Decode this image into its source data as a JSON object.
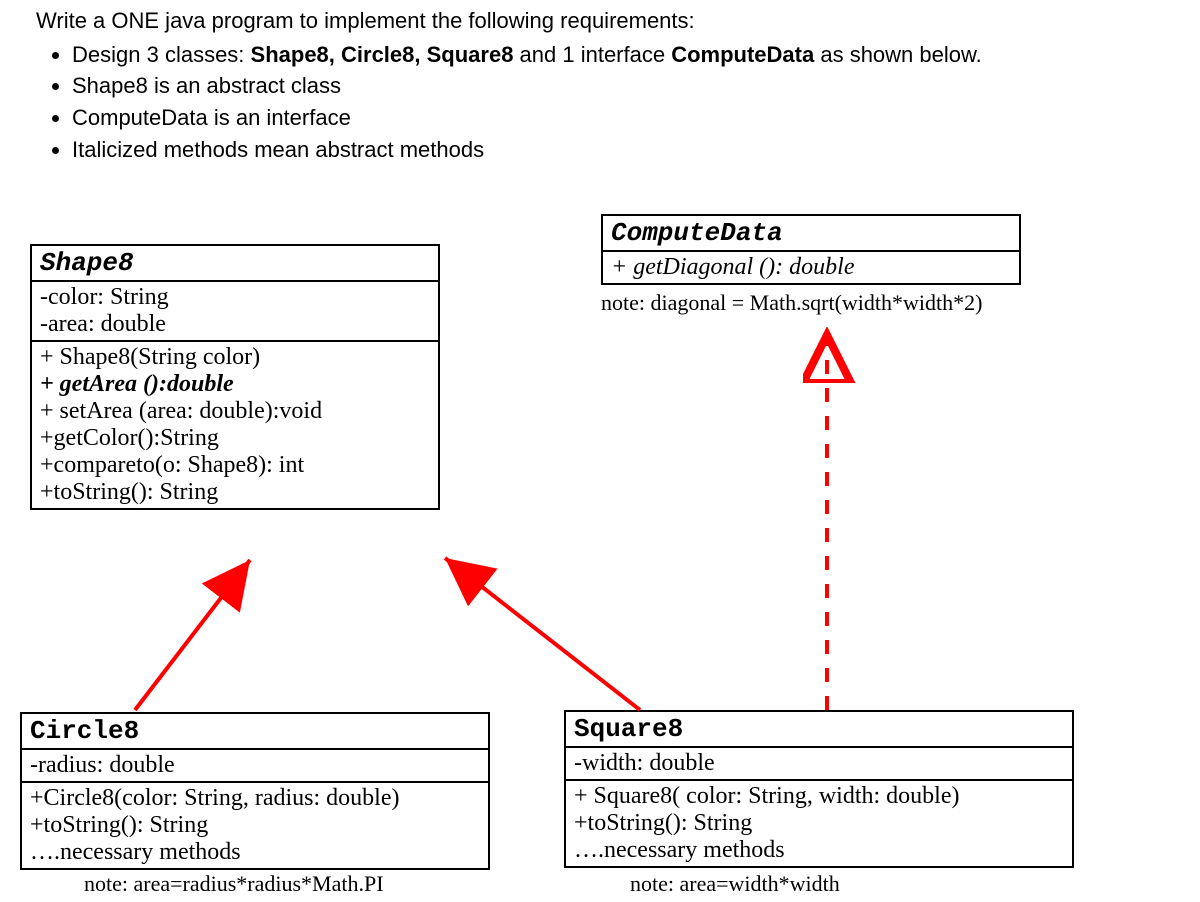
{
  "intro": {
    "title_prefix": "Write a ONE java program to implement the following requirements:",
    "bullets": [
      {
        "pre": "Design 3 classes: ",
        "b1": "Shape8, Circle8, Square8",
        "mid": " and 1 interface ",
        "b2": "ComputeData",
        "post": " as shown below."
      },
      {
        "text": "Shape8 is an abstract class"
      },
      {
        "text": "ComputeData is an interface"
      },
      {
        "text": " Italicized  methods mean abstract methods"
      }
    ]
  },
  "shape8": {
    "name": "Shape8",
    "attrs": [
      "-color: String",
      "-area: double"
    ],
    "ops": [
      "+ Shape8(String color)",
      "+ getArea ():double",
      "+ setArea (area: double):void",
      "+getColor():String",
      "+compareto(o: Shape8): int",
      "+toString(): String"
    ],
    "op_italic_index": 1
  },
  "compute": {
    "name": "ComputeData",
    "ops": [
      "+ getDiagonal (): double"
    ],
    "note": "note: diagonal = Math.sqrt(width*width*2)"
  },
  "circle8": {
    "name": "Circle8",
    "attrs": [
      "-radius: double"
    ],
    "ops": [
      "+Circle8(color: String, radius: double)",
      "+toString(): String",
      "….necessary methods"
    ],
    "note": "note: area=radius*radius*Math.PI"
  },
  "square8": {
    "name": "Square8",
    "attrs": [
      "-width: double"
    ],
    "ops": [
      "+ Square8( color: String, width: double)",
      "+toString(): String",
      "….necessary methods"
    ],
    "note": "note: area=width*width"
  },
  "chart_data": {
    "type": "uml_class_diagram",
    "classes": [
      {
        "name": "Shape8",
        "abstract": true,
        "attributes": [
          "-color: String",
          "-area: double"
        ],
        "operations": [
          "+Shape8(String color)",
          "+getArea():double (abstract)",
          "+setArea(area:double):void",
          "+getColor():String",
          "+compareto(o:Shape8):int",
          "+toString():String"
        ]
      },
      {
        "name": "ComputeData",
        "stereotype": "interface",
        "operations": [
          "+getDiagonal():double (abstract)"
        ]
      },
      {
        "name": "Circle8",
        "attributes": [
          "-radius: double"
        ],
        "operations": [
          "+Circle8(color:String, radius:double)",
          "+toString():String"
        ],
        "note": "area=radius*radius*Math.PI"
      },
      {
        "name": "Square8",
        "attributes": [
          "-width: double"
        ],
        "operations": [
          "+Square8(color:String, width:double)",
          "+toString():String"
        ],
        "note": "area=width*width"
      }
    ],
    "relations": [
      {
        "from": "Circle8",
        "to": "Shape8",
        "type": "generalization"
      },
      {
        "from": "Square8",
        "to": "Shape8",
        "type": "generalization"
      },
      {
        "from": "Square8",
        "to": "ComputeData",
        "type": "realization"
      }
    ]
  }
}
